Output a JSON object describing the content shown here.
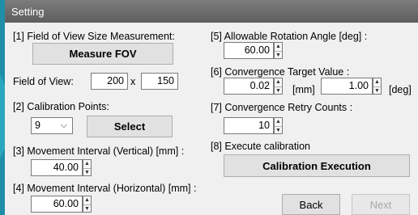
{
  "window": {
    "title": "Setting"
  },
  "fov": {
    "section_label": "[1] Field of View Size Measurement:",
    "measure_button": "Measure FOV",
    "field_label": "Field of View:",
    "width_value": "200",
    "x_separator": "x",
    "height_value": "150"
  },
  "calibration_points": {
    "section_label": "[2] Calibration Points:",
    "selected": "9",
    "select_button": "Select"
  },
  "movement_vertical": {
    "section_label": "[3] Movement Interval (Vertical) [mm] :",
    "value": "40.00"
  },
  "movement_horizontal": {
    "section_label": "[4] Movement Interval (Horizontal) [mm] :",
    "value": "60.00"
  },
  "rotation": {
    "section_label": "[5] Allowable Rotation Angle [deg] :",
    "value": "60.00"
  },
  "convergence_target": {
    "section_label": "[6] Convergence Target Value :",
    "mm_value": "0.02",
    "mm_unit": "[mm]",
    "deg_value": "1.00",
    "deg_unit": "[deg]"
  },
  "retry": {
    "section_label": "[7] Convergence Retry Counts :",
    "value": "10"
  },
  "execute": {
    "section_label": "[8] Execute calibration",
    "button": "Calibration Execution"
  },
  "footer": {
    "back": "Back",
    "next": "Next"
  },
  "icons": {
    "spin_up": "▲",
    "spin_down": "▼",
    "dropdown": "⌵"
  },
  "colors": {
    "accent_arrow": "#2aa7bf",
    "titlebar": "#6e6e6e"
  }
}
